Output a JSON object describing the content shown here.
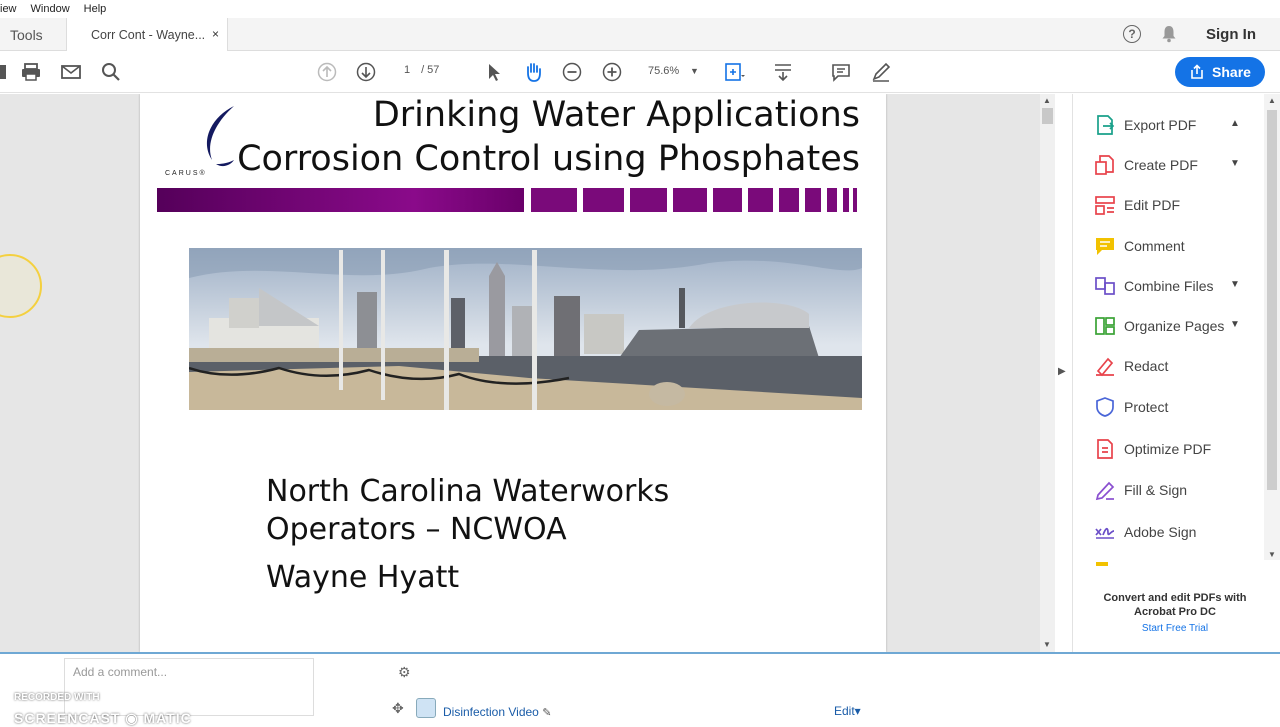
{
  "menu": [
    "iew",
    "Window",
    "Help"
  ],
  "tabs": {
    "tools": "Tools",
    "doc": "Corr Cont - Wayne...",
    "close": "×"
  },
  "header": {
    "help": "?",
    "signin": "Sign In"
  },
  "toolbar": {
    "page_current": "1",
    "page_total": "/ 57",
    "zoom": "75.6%",
    "share": "Share"
  },
  "slide": {
    "title_line1": "Drinking Water Applications",
    "title_line2": "Corrosion Control using Phosphates",
    "logo": "CARUS®",
    "body_line1": "North Carolina Waterworks",
    "body_line2": "Operators – NCWOA",
    "body_line3": "Wayne Hyatt"
  },
  "rightpane": {
    "items": [
      {
        "label": "Export PDF",
        "icon": "export-pdf-icon",
        "color": "#19a08a"
      },
      {
        "label": "Create PDF",
        "icon": "create-pdf-icon",
        "color": "#e8434b"
      },
      {
        "label": "Edit PDF",
        "icon": "edit-pdf-icon",
        "color": "#e8434b"
      },
      {
        "label": "Comment",
        "icon": "comment-icon",
        "color": "#f2c200"
      },
      {
        "label": "Combine Files",
        "icon": "combine-files-icon",
        "color": "#6b4fc8"
      },
      {
        "label": "Organize Pages",
        "icon": "organize-pages-icon",
        "color": "#3aa335"
      },
      {
        "label": "Redact",
        "icon": "redact-icon",
        "color": "#e8434b"
      },
      {
        "label": "Protect",
        "icon": "protect-icon",
        "color": "#4a66d8"
      },
      {
        "label": "Optimize PDF",
        "icon": "optimize-pdf-icon",
        "color": "#e8434b"
      },
      {
        "label": "Fill & Sign",
        "icon": "fill-sign-icon",
        "color": "#8a4fd0"
      },
      {
        "label": "Adobe Sign",
        "icon": "adobe-sign-icon",
        "color": "#6b4fc8"
      }
    ],
    "promo_title": "Convert and edit PDFs with Acrobat Pro DC",
    "promo_link": "Start Free Trial"
  },
  "bottom": {
    "comment_placeholder": "Add a comment...",
    "file_link": "Disinfection Video",
    "edit_link": "Edit▾",
    "watermark_top": "RECORDED WITH",
    "watermark_bottom": "SCREENCAST ◉ MATIC"
  },
  "colors": {
    "accent": "#1473e6",
    "band": "#7a0a7a"
  }
}
